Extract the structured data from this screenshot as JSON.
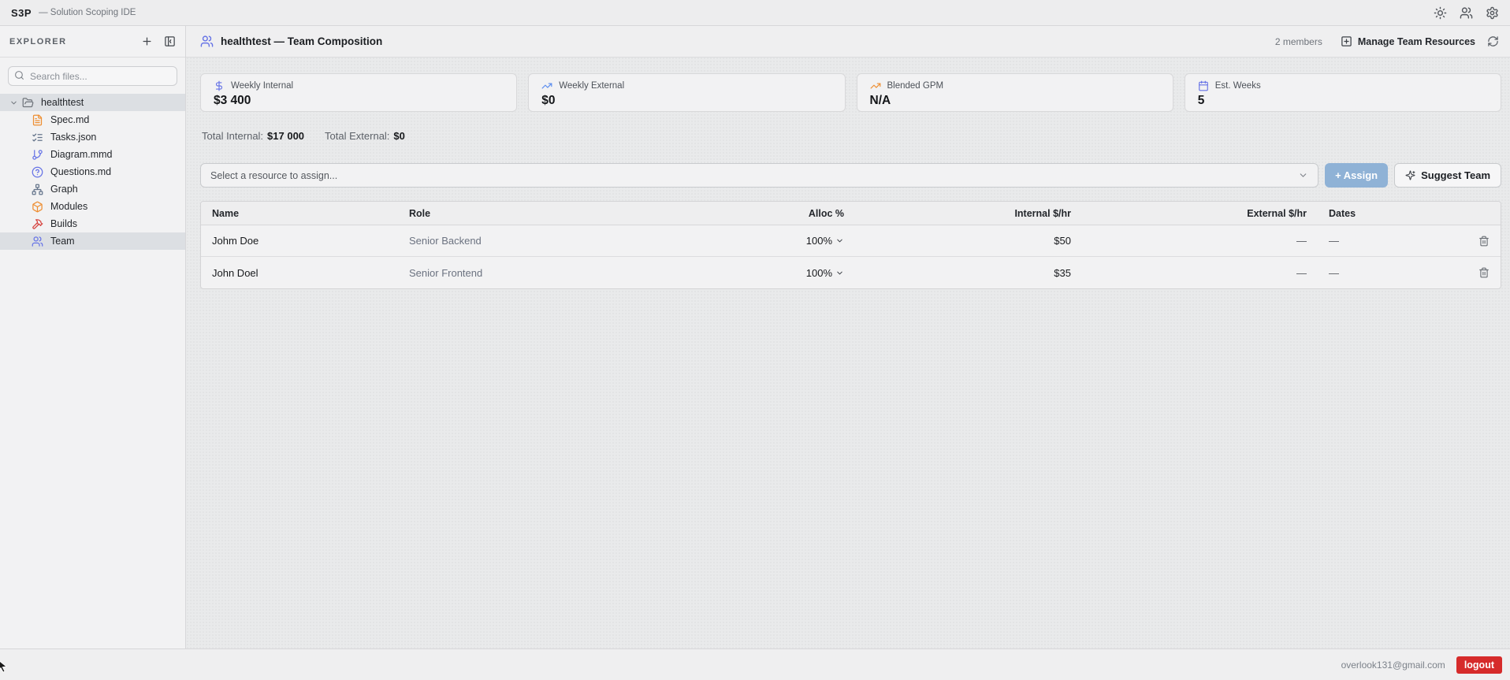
{
  "topbar": {
    "logo": "S3P",
    "subtitle": "— Solution Scoping IDE"
  },
  "sidebar": {
    "explorer_label": "EXPLORER",
    "search_placeholder": "Search files...",
    "tree": {
      "root": {
        "label": "healthtest",
        "icon": "folder-open-icon",
        "selected": true
      },
      "items": [
        {
          "label": "Spec.md",
          "icon": "file-text-icon"
        },
        {
          "label": "Tasks.json",
          "icon": "list-checks-icon"
        },
        {
          "label": "Diagram.mmd",
          "icon": "git-branch-icon"
        },
        {
          "label": "Questions.md",
          "icon": "help-circle-icon"
        },
        {
          "label": "Graph",
          "icon": "network-icon"
        },
        {
          "label": "Modules",
          "icon": "package-icon"
        },
        {
          "label": "Builds",
          "icon": "hammer-icon"
        },
        {
          "label": "Team",
          "icon": "users-icon",
          "selected": true
        }
      ]
    }
  },
  "header": {
    "title": "healthtest — Team Composition",
    "members_count": "2 members",
    "manage_label": "Manage Team Resources"
  },
  "stats": [
    {
      "label": "Weekly Internal",
      "value": "$3 400",
      "icon": "dollar-icon",
      "icon_color": "#6673e6"
    },
    {
      "label": "Weekly External",
      "value": "$0",
      "icon": "trend-up-icon",
      "icon_color": "#5b8def"
    },
    {
      "label": "Blended GPM",
      "value": "N/A",
      "icon": "trend-up-icon",
      "icon_color": "#ee8f33"
    },
    {
      "label": "Est. Weeks",
      "value": "5",
      "icon": "calendar-icon",
      "icon_color": "#6673e6"
    }
  ],
  "totals": {
    "internal_label": "Total Internal:",
    "internal_value": "$17 000",
    "external_label": "Total External:",
    "external_value": "$0"
  },
  "toolbar": {
    "select_placeholder": "Select a resource to assign...",
    "assign_label": "+ Assign",
    "suggest_label": "Suggest Team"
  },
  "table": {
    "columns": [
      "Name",
      "Role",
      "Alloc %",
      "Internal $/hr",
      "External $/hr",
      "Dates"
    ],
    "rows": [
      {
        "name": "Johm Doe",
        "role": "Senior Backend",
        "alloc": "100%",
        "internal": "$50",
        "external": "—",
        "dates": "—"
      },
      {
        "name": "John Doel",
        "role": "Senior Frontend",
        "alloc": "100%",
        "internal": "$35",
        "external": "—",
        "dates": "—"
      }
    ]
  },
  "footer": {
    "email": "overlook131@gmail.com",
    "logout_label": "logout"
  },
  "colors": {
    "accent": "#6673e6",
    "orange": "#ee8f33",
    "slate": "#64748b",
    "red": "#d64541",
    "blue": "#5b8def",
    "assign": "#8fb2d6",
    "logout": "#d62b2b"
  }
}
